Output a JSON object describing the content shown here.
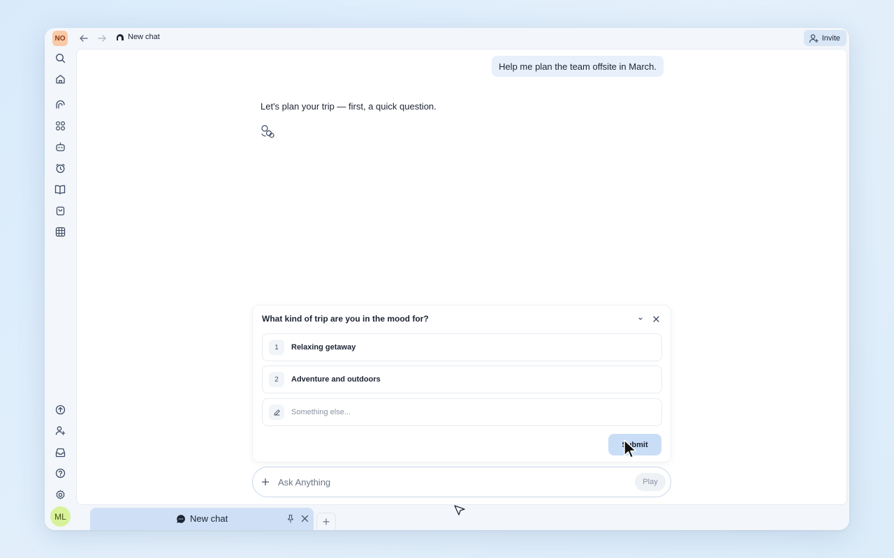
{
  "window": {
    "workspace_initials": "NO",
    "breadcrumb_title": "New chat",
    "invite_label": "Invite"
  },
  "sidebar": {
    "top_icons": [
      "search-icon",
      "home-icon",
      "spaces-icon",
      "apps-icon",
      "bot-icon",
      "alarm-icon",
      "book-icon",
      "bag-icon",
      "table-icon"
    ],
    "bottom_icons": [
      "upload-icon",
      "add-user-icon",
      "inbox-icon",
      "help-icon",
      "settings-icon"
    ],
    "user_initials": "ML"
  },
  "chat": {
    "user_message": "Help me plan the team offsite in March.",
    "assistant_message": "Let's plan your trip — first, a quick question."
  },
  "question_card": {
    "title": "What kind of trip are you in the mood for?",
    "options": [
      {
        "number": "1",
        "label": "Relaxing getaway"
      },
      {
        "number": "2",
        "label": "Adventure and outdoors"
      }
    ],
    "custom_placeholder": "Something else...",
    "submit_label": "Submit"
  },
  "composer": {
    "placeholder": "Ask Anything",
    "play_label": "Play"
  },
  "tabs": {
    "active_label": "New chat"
  },
  "colors": {
    "accent": "#c9ddf6",
    "user_bubble": "#e7f0fb",
    "workspace_avatar": "#f9c9a8",
    "user_avatar": "#d8f29a"
  }
}
